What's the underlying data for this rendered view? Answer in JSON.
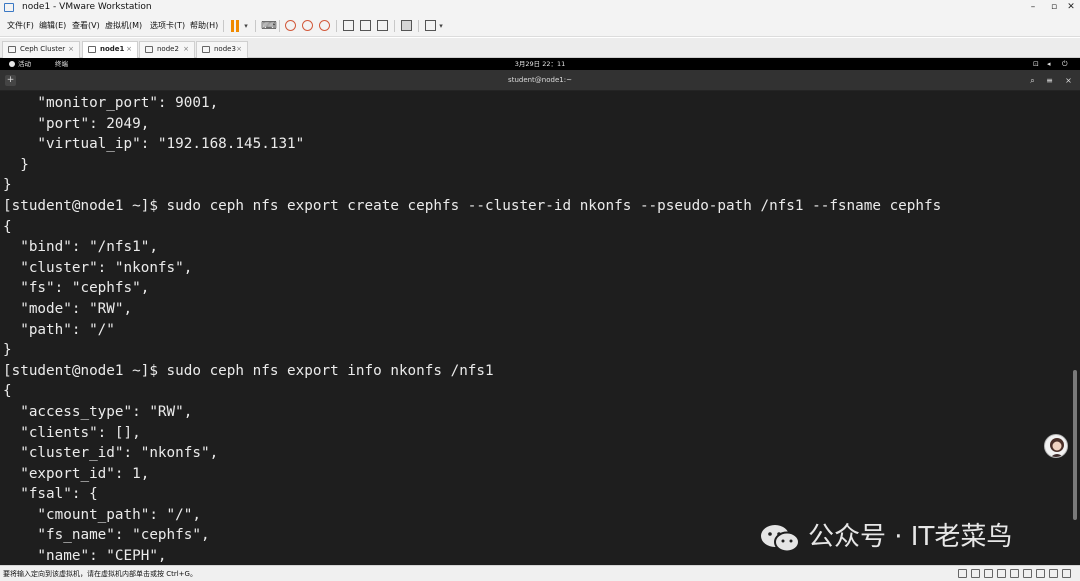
{
  "window": {
    "title": "node1 - VMware Workstation",
    "controls": [
      "–",
      "▫",
      "✕"
    ]
  },
  "menus": [
    "文件(F)",
    "编辑(E)",
    "查看(V)",
    "虚拟机(M)",
    "选项卡(T)",
    "帮助(H)"
  ],
  "tabs": [
    {
      "label": "Ceph Cluster",
      "active": false
    },
    {
      "label": "node1",
      "active": true
    },
    {
      "label": "node2",
      "active": false
    },
    {
      "label": "node3",
      "active": false
    }
  ],
  "gnome": {
    "activities": "活动",
    "app": "终端",
    "clock": "3月29日  22：11"
  },
  "terminal": {
    "title": "student@node1:~",
    "lines": [
      "    \"monitor_port\": 9001,",
      "    \"port\": 2049,",
      "    \"virtual_ip\": \"192.168.145.131\"",
      "  }",
      "}",
      "[student@node1 ~]$ sudo ceph nfs export create cephfs --cluster-id nkonfs --pseudo-path /nfs1 --fsname cephfs",
      "{",
      "  \"bind\": \"/nfs1\",",
      "  \"cluster\": \"nkonfs\",",
      "  \"fs\": \"cephfs\",",
      "  \"mode\": \"RW\",",
      "  \"path\": \"/\"",
      "}",
      "[student@node1 ~]$ sudo ceph nfs export info nkonfs /nfs1",
      "{",
      "  \"access_type\": \"RW\",",
      "  \"clients\": [],",
      "  \"cluster_id\": \"nkonfs\",",
      "  \"export_id\": 1,",
      "  \"fsal\": {",
      "    \"cmount_path\": \"/\",",
      "    \"fs_name\": \"cephfs\",",
      "    \"name\": \"CEPH\","
    ]
  },
  "watermark": "公众号 · IT老菜鸟",
  "status": {
    "text": "要将输入定向到该虚拟机，请在虚拟机内部单击或按 Ctrl+G。"
  }
}
